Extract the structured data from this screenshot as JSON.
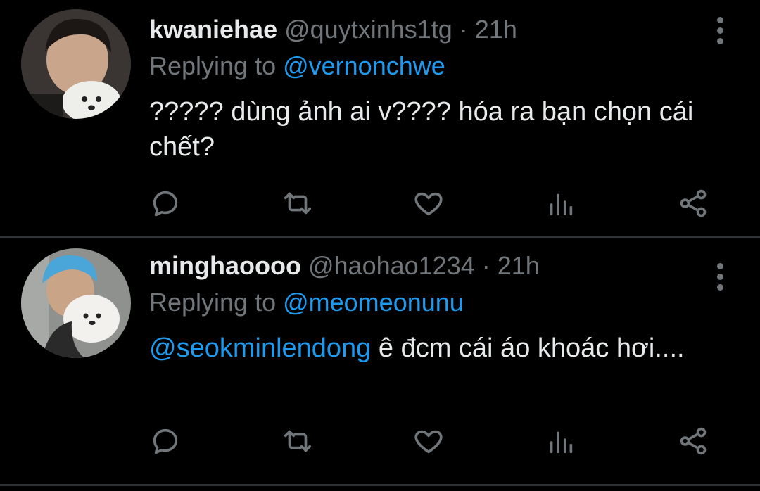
{
  "tweets": [
    {
      "display_name": "kwaniehae",
      "handle": "@quytxinhs1tg",
      "separator": " · ",
      "time": "21h",
      "replying_prefix": "Replying to ",
      "replying_to": "@vernonchwe",
      "mention": "",
      "text": "????? dùng ảnh ai v???? hóa ra bạn chọn cái chết?",
      "avatar_icon": "avatar-person-with-white-dog"
    },
    {
      "display_name": "minghaoooo",
      "handle": "@haohao1234",
      "separator": " · ",
      "time": "21h",
      "replying_prefix": "Replying to ",
      "replying_to": "@meomeonunu",
      "mention": "@seokminlendong",
      "text": " ê đcm cái áo khoác hơi....",
      "avatar_icon": "avatar-blue-hair-person-with-white-dog"
    }
  ],
  "actions": [
    "reply-icon",
    "retweet-icon",
    "like-icon",
    "stats-icon",
    "share-icon"
  ],
  "colors": {
    "background": "#000000",
    "text": "#e7e9ea",
    "muted": "#71767b",
    "link": "#1d9bf0",
    "divider": "#2f3336"
  }
}
